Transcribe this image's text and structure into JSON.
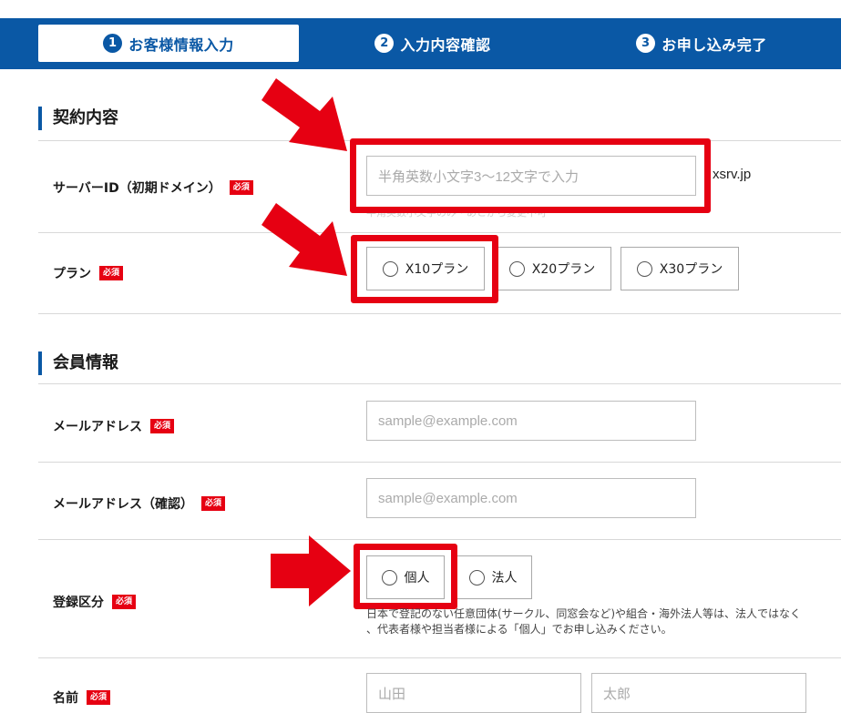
{
  "steps": [
    {
      "number": "1",
      "label": "お客様情報入力",
      "active": true
    },
    {
      "number": "2",
      "label": "入力内容確認",
      "active": false
    },
    {
      "number": "3",
      "label": "お申し込み完了",
      "active": false
    }
  ],
  "contract": {
    "title": "契約内容",
    "server_id": {
      "label": "サーバーID（初期ドメイン）",
      "required": "必須",
      "placeholder": "半角英数小文字3〜12文字で入力",
      "suffix": "xsrv.jp",
      "hint": "半角英数小文字のみ・あとから変更不可"
    },
    "plan": {
      "label": "プラン",
      "required": "必須",
      "options": [
        "X10プラン",
        "X20プラン",
        "X30プラン"
      ]
    }
  },
  "member": {
    "title": "会員情報",
    "email": {
      "label": "メールアドレス",
      "required": "必須",
      "placeholder": "sample@example.com"
    },
    "email_confirm": {
      "label": "メールアドレス（確認）",
      "required": "必須",
      "placeholder": "sample@example.com"
    },
    "registration_type": {
      "label": "登録区分",
      "required": "必須",
      "options": [
        "個人",
        "法人"
      ],
      "note_line1": "日本で登記のない任意団体(サークル、同窓会など)や組合・海外法人等は、法人ではなく",
      "note_line2": "、代表者様や担当者様による「個人」でお申し込みください。"
    },
    "name": {
      "label": "名前",
      "required": "必須",
      "last_placeholder": "山田",
      "first_placeholder": "太郎"
    }
  },
  "colors": {
    "brand": "#0a58a5",
    "highlight": "#e60012"
  }
}
